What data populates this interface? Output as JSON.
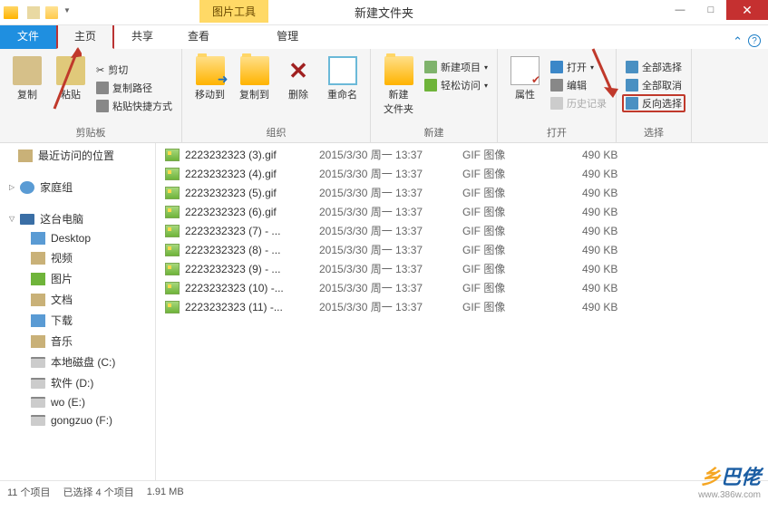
{
  "window": {
    "title": "新建文件夹",
    "contextual_tab": "图片工具"
  },
  "tabs": {
    "file": "文件",
    "home": "主页",
    "share": "共享",
    "view": "查看",
    "manage": "管理"
  },
  "ribbon": {
    "clipboard": {
      "label": "剪贴板",
      "copy": "复制",
      "paste": "粘贴",
      "cut": "剪切",
      "copy_path": "复制路径",
      "paste_shortcut": "粘贴快捷方式"
    },
    "organize": {
      "label": "组织",
      "move_to": "移动到",
      "copy_to": "复制到",
      "delete": "删除",
      "rename": "重命名"
    },
    "new": {
      "label": "新建",
      "new_folder": "新建\n文件夹",
      "new_item": "新建项目",
      "easy_access": "轻松访问"
    },
    "open": {
      "label": "打开",
      "properties": "属性",
      "open": "打开",
      "edit": "编辑",
      "history": "历史记录"
    },
    "select": {
      "label": "选择",
      "select_all": "全部选择",
      "select_none": "全部取消",
      "invert": "反向选择"
    }
  },
  "sidebar": {
    "recent": "最近访问的位置",
    "homegroup": "家庭组",
    "this_pc": "这台电脑",
    "items": [
      {
        "label": "Desktop"
      },
      {
        "label": "视频"
      },
      {
        "label": "图片"
      },
      {
        "label": "文档"
      },
      {
        "label": "下载"
      },
      {
        "label": "音乐"
      },
      {
        "label": "本地磁盘 (C:)"
      },
      {
        "label": "软件 (D:)"
      },
      {
        "label": "wo (E:)"
      },
      {
        "label": "gongzuo (F:)"
      }
    ]
  },
  "files": [
    {
      "name": "2223232323 (3).gif",
      "date": "2015/3/30 周一 13:37",
      "type": "GIF 图像",
      "size": "490 KB"
    },
    {
      "name": "2223232323 (4).gif",
      "date": "2015/3/30 周一 13:37",
      "type": "GIF 图像",
      "size": "490 KB"
    },
    {
      "name": "2223232323 (5).gif",
      "date": "2015/3/30 周一 13:37",
      "type": "GIF 图像",
      "size": "490 KB"
    },
    {
      "name": "2223232323 (6).gif",
      "date": "2015/3/30 周一 13:37",
      "type": "GIF 图像",
      "size": "490 KB"
    },
    {
      "name": "2223232323 (7) - ...",
      "date": "2015/3/30 周一 13:37",
      "type": "GIF 图像",
      "size": "490 KB"
    },
    {
      "name": "2223232323 (8) - ...",
      "date": "2015/3/30 周一 13:37",
      "type": "GIF 图像",
      "size": "490 KB"
    },
    {
      "name": "2223232323 (9) - ...",
      "date": "2015/3/30 周一 13:37",
      "type": "GIF 图像",
      "size": "490 KB"
    },
    {
      "name": "2223232323 (10) -...",
      "date": "2015/3/30 周一 13:37",
      "type": "GIF 图像",
      "size": "490 KB"
    },
    {
      "name": "2223232323 (11) -...",
      "date": "2015/3/30 周一 13:37",
      "type": "GIF 图像",
      "size": "490 KB"
    }
  ],
  "status": {
    "items": "11 个项目",
    "selected": "已选择 4 个项目",
    "size": "1.91 MB"
  },
  "watermark": {
    "text": "乡巴佬",
    "url": "www.386w.com"
  }
}
